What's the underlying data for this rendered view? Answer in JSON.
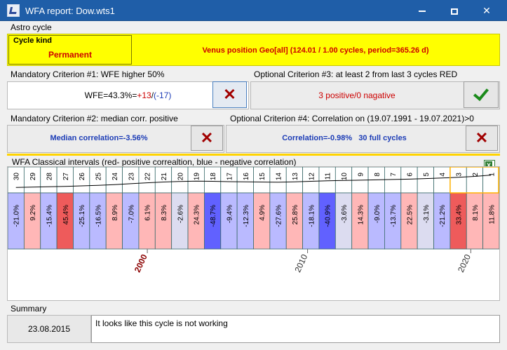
{
  "window": {
    "title": "WFA report: Dow.wts1"
  },
  "header": {
    "section_label": "Astro cycle",
    "cycle_kind_label": "Cycle kind",
    "cycle_kind_value": "Permanent",
    "venus_text": "Venus position Geo[all]  (124.01 / 1.00 cycles, period=365.26 d)"
  },
  "criteria": {
    "c1": {
      "label": "Mandatory Criterion #1: WFE higher 50%",
      "value_prefix": "WFE=43.3%=",
      "value_pos": "+13",
      "value_sep": "/",
      "value_neg": "(-17)"
    },
    "c2": {
      "label": "Mandatory Criterion #2: median  corr.  positive",
      "value": "Median correlation=-3.56%"
    },
    "c3": {
      "label": "Optional Criterion #3: at least 2 from last 3 cycles RED",
      "value": "3 positive/0 nagative"
    },
    "c4": {
      "label": "Optional Criterion #4: Correlation on (19.07.1991 - 19.07.2021)>0",
      "value_corr": "Correlation=-0.98%",
      "value_cycles": "30 full cycles"
    }
  },
  "chart": {
    "label": "WFA Classical intervals (red- positive correaltion, blue - negative correlation)",
    "colors": {
      "positive": "#ffb7b7",
      "positive_strong": "#ee5b5b",
      "negative": "#babaff",
      "negative_strong": "#6161ff",
      "neutral": "#dcdcf0",
      "highlight": "#ffb200"
    }
  },
  "chart_data": {
    "type": "bar",
    "categories": [
      "30",
      "29",
      "28",
      "27",
      "26",
      "25",
      "24",
      "23",
      "22",
      "21",
      "20",
      "19",
      "18",
      "17",
      "16",
      "15",
      "14",
      "13",
      "12",
      "11",
      "10",
      "9",
      "8",
      "7",
      "6",
      "5",
      "4",
      "3",
      "2",
      "1"
    ],
    "values": [
      -21.0,
      9.2,
      -15.4,
      45.4,
      -25.1,
      -16.5,
      8.9,
      -7.0,
      6.1,
      8.3,
      -2.6,
      24.3,
      -48.7,
      -9.4,
      -12.3,
      4.9,
      -27.6,
      25.8,
      -18.1,
      -40.9,
      -3.6,
      14.3,
      -9.0,
      -13.7,
      22.5,
      -3.1,
      -21.2,
      33.4,
      8.1,
      11.8
    ],
    "value_labels": [
      "-21.0%",
      "9.2%",
      "-15.4%",
      "45.4%",
      "-25.1%",
      "-16.5%",
      "8.9%",
      "-7.0%",
      "6.1%",
      "8.3%",
      "-2.6%",
      "24.3%",
      "-48.7%",
      "-9.4%",
      "-12.3%",
      "4.9%",
      "-27.6%",
      "25.8%",
      "-18.1%",
      "-40.9%",
      "-3.6%",
      "14.3%",
      "-9.0%",
      "-13.7%",
      "22.5%",
      "-3.1%",
      "-21.2%",
      "33.4%",
      "8.1%",
      "11.8%"
    ],
    "x_ticks": [
      {
        "label": "2000",
        "highlight": true,
        "position": 0.284
      },
      {
        "label": "2010",
        "highlight": false,
        "position": 0.61
      },
      {
        "label": "2020",
        "highlight": false,
        "position": 0.942
      }
    ],
    "price_line": [
      0.18,
      0.2,
      0.22,
      0.24,
      0.27,
      0.3,
      0.34,
      0.39,
      0.44,
      0.48,
      0.51,
      0.53,
      0.52,
      0.5,
      0.49,
      0.48,
      0.47,
      0.49,
      0.52,
      0.55,
      0.57,
      0.58,
      0.6,
      0.62,
      0.64,
      0.67,
      0.7,
      0.74,
      0.79,
      0.86
    ]
  },
  "summary": {
    "label": "Summary",
    "date": "23.08.2015",
    "text": "It looks like this cycle is not working"
  }
}
